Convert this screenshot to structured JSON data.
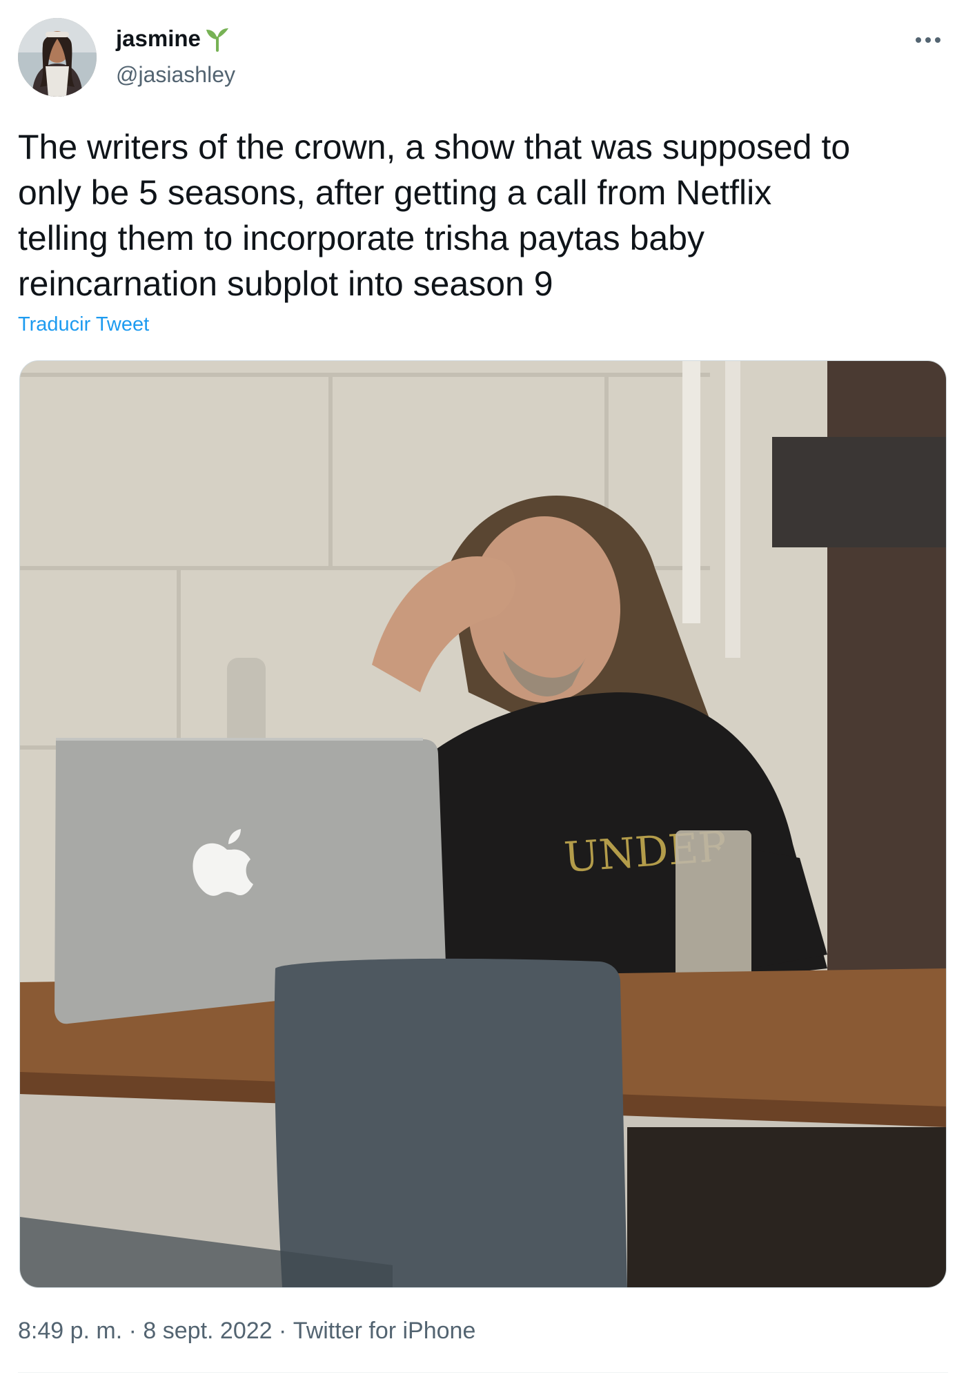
{
  "author": {
    "display_name": "jasmine",
    "handle": "@jasiashley",
    "name_emoji_icon": "seedling-icon"
  },
  "tweet": {
    "text": "The writers of the crown, a show that was supposed to\nonly be 5 seasons, after getting a call from Netflix\ntelling them to incorporate trisha paytas baby\nreincarnation subplot into season 9",
    "translate_label": "Traducir Tweet",
    "time": "8:49 p. m.",
    "separator": " · ",
    "date": "8 sept. 2022",
    "source": "Twitter for iPhone"
  },
  "media": {
    "laptop_logo_icon": "apple-logo-icon"
  },
  "colors": {
    "link": "#1d9bf0",
    "secondary_text": "#536471",
    "primary_text": "#0f1419",
    "sprout_green": "#77b255"
  }
}
